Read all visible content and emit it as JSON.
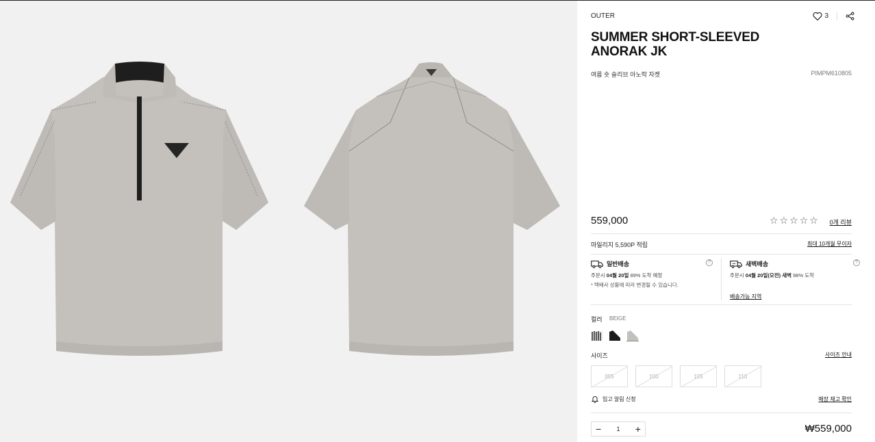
{
  "product": {
    "category": "OUTER",
    "title": "SUMMER SHORT-SLEEVED ANORAK JK",
    "subtitle": "여름 숏 슬리브 아노락 자켓",
    "code": "PIMPM610805",
    "likes": "3",
    "price": "559,000",
    "rating": 0,
    "review_link": "0개 리뷰"
  },
  "benefits": {
    "mileage": "마일리지 5,590P 적립",
    "installment_link": "최대 10개월 무이자"
  },
  "shipping": {
    "standard": {
      "title": "일반배송",
      "line_prefix": "주문시",
      "date": "04월 20일",
      "rate": "89% 도착 예정",
      "note": "* 택배사 상황에 따라 변경될 수 있습니다."
    },
    "dawn": {
      "title": "새벽배송",
      "line_prefix": "주문시",
      "date": "04월 20일(오전) 새벽",
      "rate": "98% 도착",
      "link": "배송가능 지역"
    }
  },
  "options": {
    "color_label": "컬러",
    "color_value": "BEIGE",
    "size_label": "사이즈",
    "size_guide": "사이즈 안내",
    "sizes": [
      "095",
      "100",
      "105",
      "110"
    ],
    "restock": "입고 알림 신청",
    "store_stock": "매장 재고 확인"
  },
  "order": {
    "quantity": "1",
    "total": "₩559,000"
  },
  "colors": {
    "garment": "#c4c1bd",
    "garment_shade": "#b3b0ac",
    "gallery_bg": "#f1f1f1"
  }
}
